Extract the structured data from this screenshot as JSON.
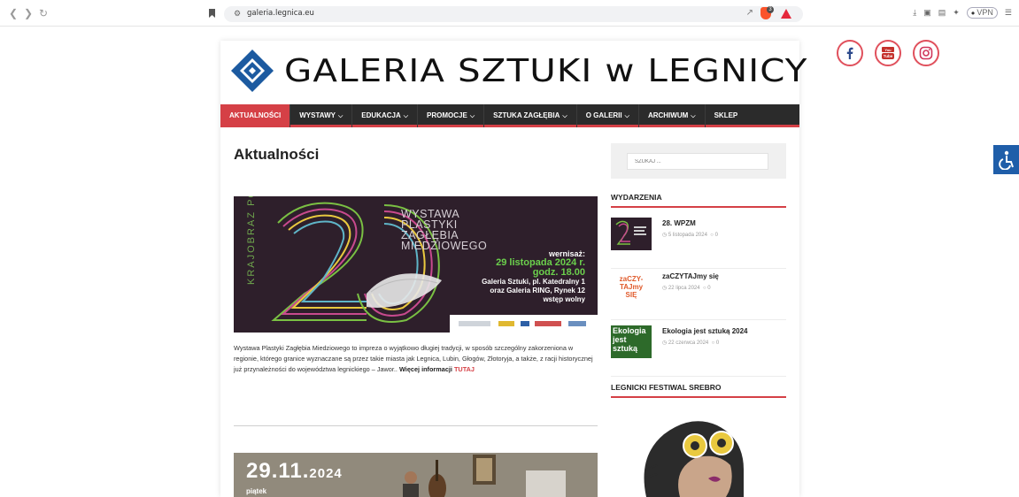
{
  "browser": {
    "url": "galeria.legnica.eu",
    "vpn_label": "VPN"
  },
  "site": {
    "logo_text": "GALERIA SZTUKI w LEGNICY",
    "nav": [
      {
        "label": "AKTUALNOŚCI",
        "active": true,
        "dropdown": false
      },
      {
        "label": "WYSTAWY",
        "active": false,
        "dropdown": true
      },
      {
        "label": "EDUKACJA",
        "active": false,
        "dropdown": true
      },
      {
        "label": "PROMOCJE",
        "active": false,
        "dropdown": true
      },
      {
        "label": "SZTUKA ZAGŁĘBIA",
        "active": false,
        "dropdown": true
      },
      {
        "label": "O GALERII",
        "active": false,
        "dropdown": true
      },
      {
        "label": "ARCHIWUM",
        "active": false,
        "dropdown": true
      },
      {
        "label": "SKLEP",
        "active": false,
        "dropdown": false
      }
    ],
    "accent_color": "#d54046"
  },
  "main": {
    "page_title": "Aktualności",
    "post1": {
      "image": {
        "side_text": "KRAJOBRAZ PO—",
        "title_lines": [
          "WYSTAWA",
          "PLASTYKI",
          "ZAGŁĘBIA",
          "MIEDZIOWEGO"
        ],
        "wernisaz": "wernisaż:",
        "date_line": "29 listopada 2024 r.",
        "time_line": "godz. 18.00",
        "place1": "Galeria Sztuki, pl. Katedralny 1",
        "place2": "oraz Galeria RING, Rynek 12",
        "entry": "wstęp wolny"
      },
      "excerpt": "Wystawa Plastyki Zagłębia Miedziowego to impreza o wyjątkowo długiej tradycji, w sposób szczególny zakorzeniona w regionie, którego granice wyznaczane są przez takie miasta jak Legnica, Lubin, Głogów, Złotoryja, a także, z racji historycznej już przynależności do województwa legnickiego – Jawor..",
      "more_label": "Więcej informacji",
      "more_link": "TUTAJ"
    },
    "post2": {
      "date_big": "29.11.",
      "year": "2024",
      "day": "piątek"
    }
  },
  "sidebar": {
    "search_placeholder": "SZUKAJ ...",
    "events_title": "WYDARZENIA",
    "events": [
      {
        "title": "28. WPZM",
        "date": "5 listopada 2024",
        "comments": "0"
      },
      {
        "title": "zaCZYTAJmy się",
        "date": "22 lipca 2024",
        "comments": "0"
      },
      {
        "title": "Ekologia jest sztuką 2024",
        "date": "22 czerwca 2024",
        "comments": "0"
      }
    ],
    "festival_title": "LEGNICKI FESTIWAL SREBRO",
    "thumb2_text": "zaCZY-TAJmy SIĘ",
    "thumb3_text": "Ekologia jest sztuką"
  }
}
